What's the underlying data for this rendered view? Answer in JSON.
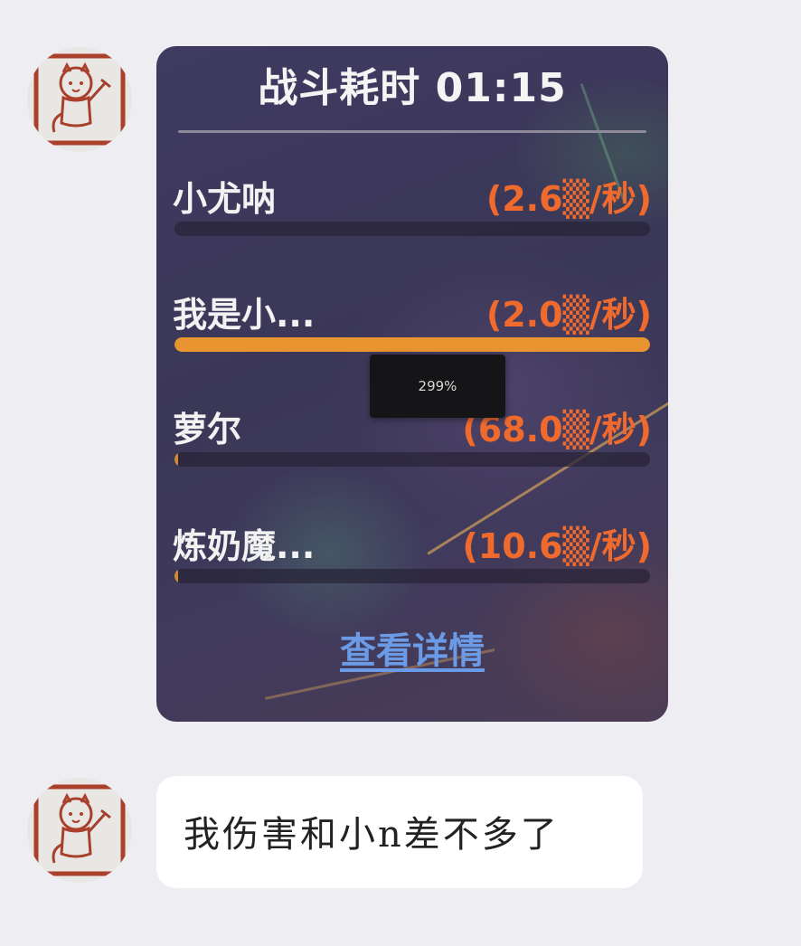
{
  "messages": [
    {
      "type": "battle_card",
      "avatar": "cat-avatar",
      "card": {
        "title": "战斗耗时 01:15",
        "rows": [
          {
            "name": "小尤呐",
            "value": "(2.6▒/秒)",
            "bar_fraction": 0.0
          },
          {
            "name": "我是小...",
            "value": "(2.0▒/秒)",
            "bar_fraction": 1.0
          },
          {
            "name": "萝尔",
            "value": "(68.0▒/秒)",
            "bar_fraction": 0.01
          },
          {
            "name": "炼奶魔...",
            "value": "(10.6▒/秒)",
            "bar_fraction": 0.01
          }
        ],
        "details_label": "查看详情"
      }
    },
    {
      "type": "text",
      "avatar": "cat-avatar",
      "text": "我伤害和小n差不多了"
    }
  ],
  "zoom_indicator": "299%",
  "colors": {
    "page_bg": "#ededf2",
    "value_text": "#f06a2e",
    "bar_fill": "#e89430",
    "link": "#6b9be6"
  }
}
